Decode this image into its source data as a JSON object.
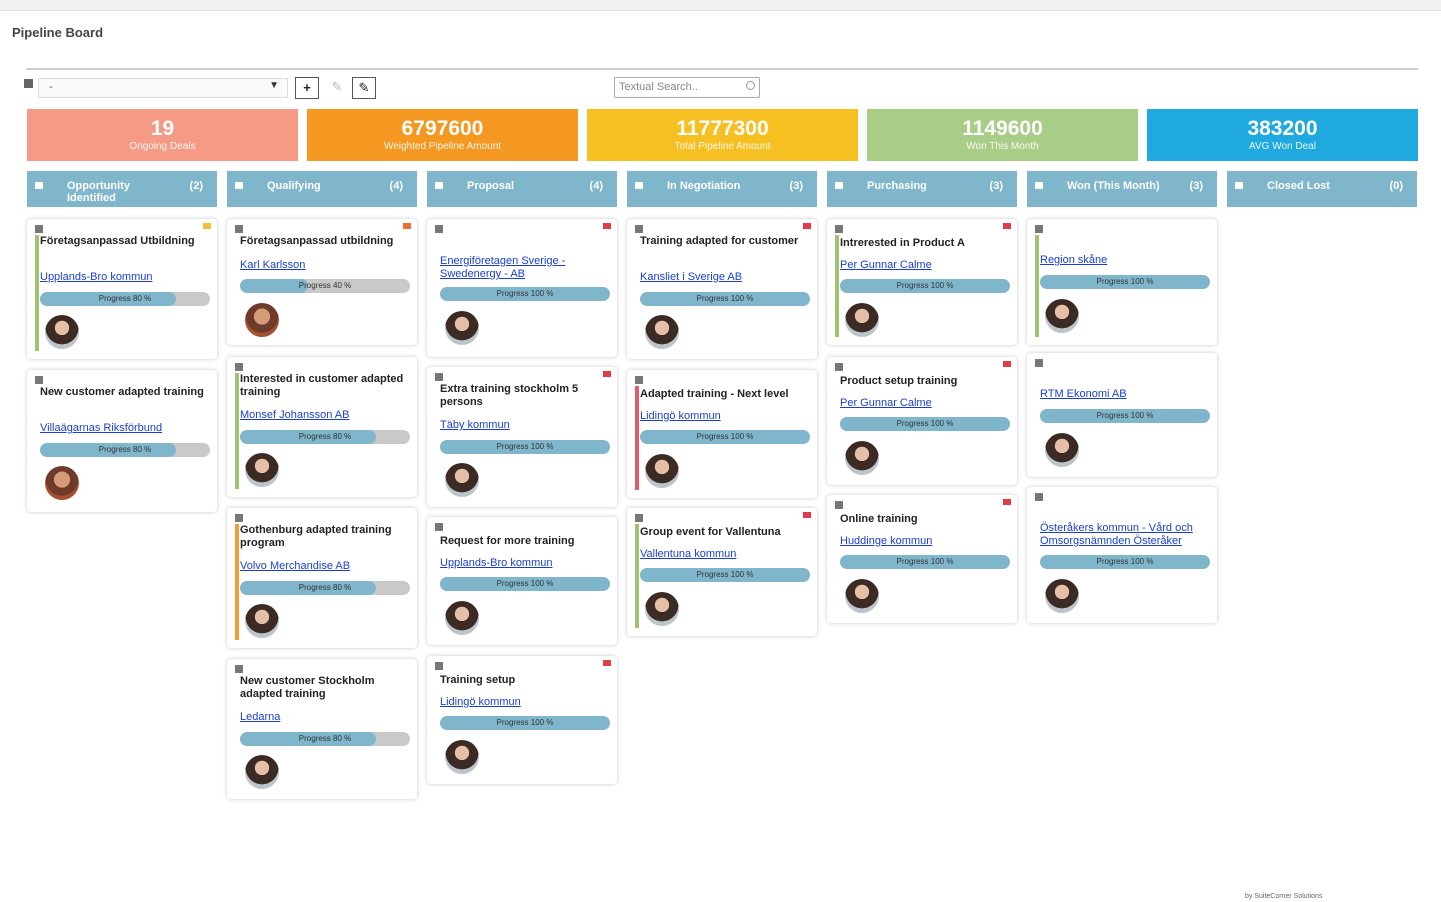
{
  "page": {
    "title": "Pipeline Board"
  },
  "toolbar": {
    "view_select_value": "-",
    "add_label": "+",
    "edit_disabled_label": "✎",
    "edit_label": "✎",
    "search_placeholder": "Textual Search..",
    "icons": [
      "menu-icon",
      "chevron-down-icon",
      "plus-icon",
      "pencil-icon",
      "search-icon"
    ]
  },
  "kpis": [
    {
      "value": "19",
      "label": "Ongoing Deals",
      "color": "#f59a85"
    },
    {
      "value": "6797600",
      "label": "Weighted Pipeline Amount",
      "color": "#f49822"
    },
    {
      "value": "11777300",
      "label": "Total Pipeline Amount",
      "color": "#f6bf22"
    },
    {
      "value": "1149600",
      "label": "Won This Month",
      "color": "#a9cc86"
    },
    {
      "value": "383200",
      "label": "AVG Won Deal",
      "color": "#20a9de"
    }
  ],
  "stages": [
    {
      "name": "Opportunity Identified",
      "count": "(2)"
    },
    {
      "name": "Qualifying",
      "count": "(4)"
    },
    {
      "name": "Proposal",
      "count": "(4)"
    },
    {
      "name": "In Negotiation",
      "count": "(3)"
    },
    {
      "name": "Purchasing",
      "count": "(3)"
    },
    {
      "name": "Won (This Month)",
      "count": "(3)"
    },
    {
      "name": "Closed Lost",
      "count": "(0)"
    }
  ],
  "cards": [
    {
      "title": "Företagsanpassad Utbildning",
      "company": "Upplands-Bro kommun",
      "progress_label": "Progress 80 %",
      "progress": 0.8,
      "flag_color": "#f0c232",
      "accent_color": "#9ec46d"
    },
    {
      "title": "New customer adapted training",
      "company": "Villaägarnas Riksförbund",
      "progress_label": "Progress 80 %",
      "progress": 0.8,
      "flag_color": "",
      "accent_color": ""
    },
    {
      "title": "Företagsanpassad utbildning",
      "company": "Karl Karlsson",
      "progress_label": "Progress 40 %",
      "progress": 0.4,
      "flag_color": "#f06b2e",
      "accent_color": ""
    },
    {
      "title": "Interested in customer adapted training",
      "company": "Monsef Johansson AB",
      "progress_label": "Progress 80 %",
      "progress": 0.8,
      "flag_color": "",
      "accent_color": "#9ec46d"
    },
    {
      "title": "Gothenburg adapted training program",
      "company": "Volvo Merchandise AB",
      "progress_label": "Progress 80 %",
      "progress": 0.8,
      "flag_color": "",
      "accent_color": "#f0a030"
    },
    {
      "title": "New customer Stockholm adapted training",
      "company": "Ledarna",
      "progress_label": "Progress 80 %",
      "progress": 0.8,
      "flag_color": "",
      "accent_color": ""
    },
    {
      "title": "",
      "company": "Energiföretagen Sverige - Swedenergy - AB",
      "progress_label": "Progress 100 %",
      "progress": 1.0,
      "flag_color": "#e23c4a",
      "accent_color": ""
    },
    {
      "title": "Extra training stockholm 5 persons",
      "company": "Täby kommun",
      "progress_label": "Progress 100 %",
      "progress": 1.0,
      "flag_color": "#e23c4a",
      "accent_color": ""
    },
    {
      "title": "Request for more training",
      "company": "Upplands-Bro kommun",
      "progress_label": "Progress 100 %",
      "progress": 1.0,
      "flag_color": "",
      "accent_color": ""
    },
    {
      "title": "Training setup",
      "company": "Lidingö kommun",
      "progress_label": "Progress 100 %",
      "progress": 1.0,
      "flag_color": "#e23c4a",
      "accent_color": ""
    },
    {
      "title": "Training adapted for customer",
      "company": "Kansliet i Sverige AB",
      "progress_label": "Progress 100 %",
      "progress": 1.0,
      "flag_color": "#e23c4a",
      "accent_color": ""
    },
    {
      "title": "Adapted training - Next level",
      "company": "Lidingö kommun",
      "progress_label": "Progress 100 %",
      "progress": 1.0,
      "flag_color": "",
      "accent_color": "#e05a6a"
    },
    {
      "title": "Group event for Vallentuna",
      "company": "Vallentuna kommun",
      "progress_label": "Progress 100 %",
      "progress": 1.0,
      "flag_color": "#e23c4a",
      "accent_color": "#9ec46d"
    },
    {
      "title": "Intrerested in Product A",
      "company": "Per Gunnar Calme",
      "progress_label": "Progress 100 %",
      "progress": 1.0,
      "flag_color": "#e23c4a",
      "accent_color": "#9ec46d"
    },
    {
      "title": "Product setup training",
      "company": "Per Gunnar Calme",
      "progress_label": "Progress 100 %",
      "progress": 1.0,
      "flag_color": "#e23c4a",
      "accent_color": ""
    },
    {
      "title": "Online training",
      "company": "Huddinge kommun",
      "progress_label": "Progress 100 %",
      "progress": 1.0,
      "flag_color": "#e23c4a",
      "accent_color": ""
    },
    {
      "title": "",
      "company": "Region skåne",
      "progress_label": "Progress 100 %",
      "progress": 1.0,
      "flag_color": "",
      "accent_color": "#9ec46d"
    },
    {
      "title": "",
      "company": "RTM Ekonomi AB",
      "progress_label": "Progress 100 %",
      "progress": 1.0,
      "flag_color": "",
      "accent_color": ""
    },
    {
      "title": "",
      "company": "Österåkers kommun - Vård och Omsorgsnämnden Österåker",
      "progress_label": "Progress 100 %",
      "progress": 1.0,
      "flag_color": "",
      "accent_color": ""
    }
  ],
  "footer": {
    "note": "by SuiteCorner Solutions"
  }
}
